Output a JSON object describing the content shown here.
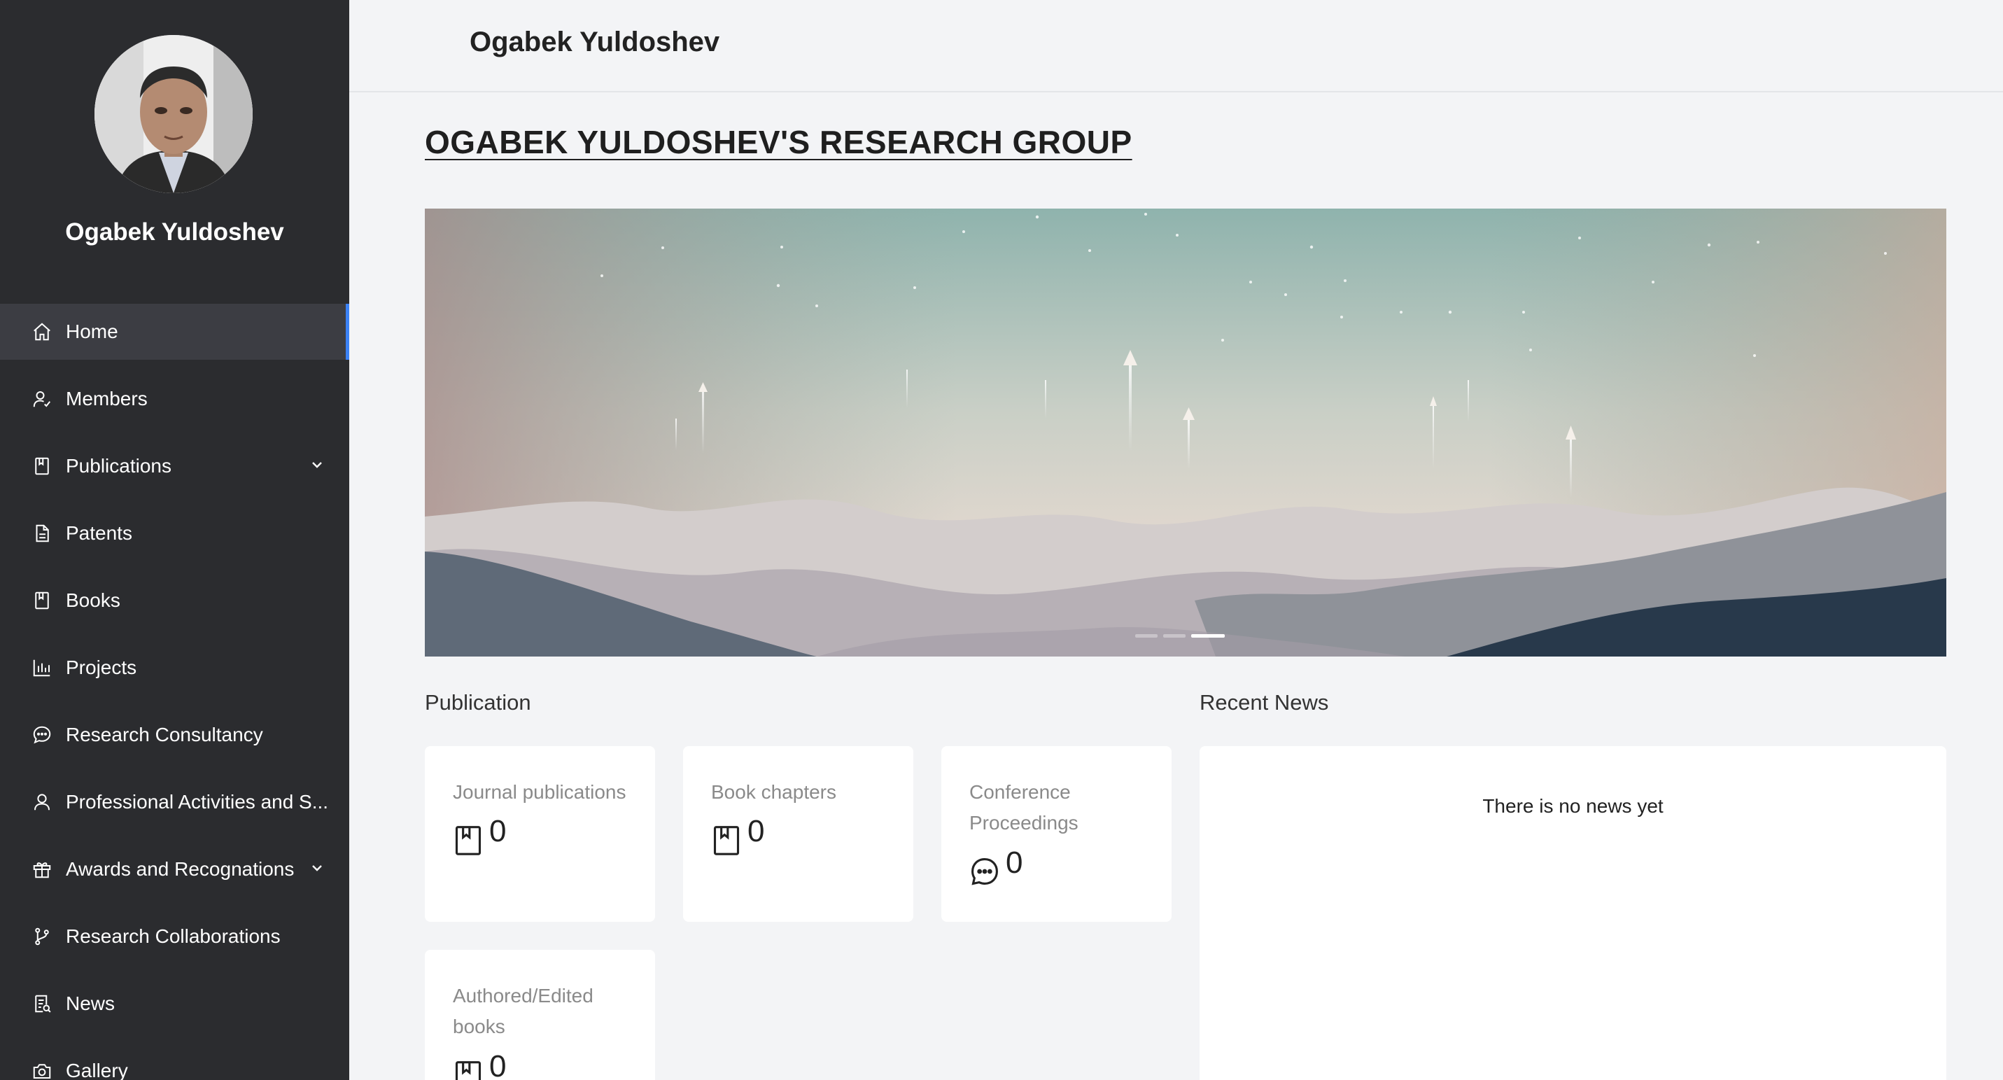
{
  "profile": {
    "name": "Ogabek Yuldoshev"
  },
  "nav": [
    {
      "label": "Home",
      "icon": "home-icon",
      "active": true
    },
    {
      "label": "Members",
      "icon": "members-icon"
    },
    {
      "label": "Publications",
      "icon": "book-icon",
      "expandable": true
    },
    {
      "label": "Patents",
      "icon": "document-icon"
    },
    {
      "label": "Books",
      "icon": "book-icon"
    },
    {
      "label": "Projects",
      "icon": "bar-chart-icon"
    },
    {
      "label": "Research Consultancy",
      "icon": "chat-icon"
    },
    {
      "label": "Professional Activities and S...",
      "icon": "user-icon"
    },
    {
      "label": "Awards and Recognations",
      "icon": "gift-icon",
      "expandable": true
    },
    {
      "label": "Research Collaborations",
      "icon": "branch-icon"
    },
    {
      "label": "News",
      "icon": "news-icon"
    },
    {
      "label": "Gallery",
      "icon": "camera-icon"
    }
  ],
  "header": {
    "title": "Ogabek Yuldoshev"
  },
  "main": {
    "group_title": "OGABEK YULDOSHEV'S RESEARCH GROUP",
    "carousel": {
      "slides": 3,
      "active_index": 2
    },
    "publication_title": "Publication",
    "news_title": "Recent News",
    "news_empty": "There is no news yet",
    "cards": [
      {
        "title": "Journal publications",
        "value": "0",
        "icon": "book-icon"
      },
      {
        "title": "Book chapters",
        "value": "0",
        "icon": "book-icon"
      },
      {
        "title": "Conference Proceedings",
        "value": "0",
        "icon": "chat-bubble-icon"
      },
      {
        "title": "Authored/Edited books",
        "value": "0",
        "icon": "book-icon"
      }
    ]
  },
  "colors": {
    "sidebar": "#2b2c2f",
    "active_item": "#3c3d43",
    "accent": "#3b82f6",
    "background": "#f3f4f6"
  }
}
